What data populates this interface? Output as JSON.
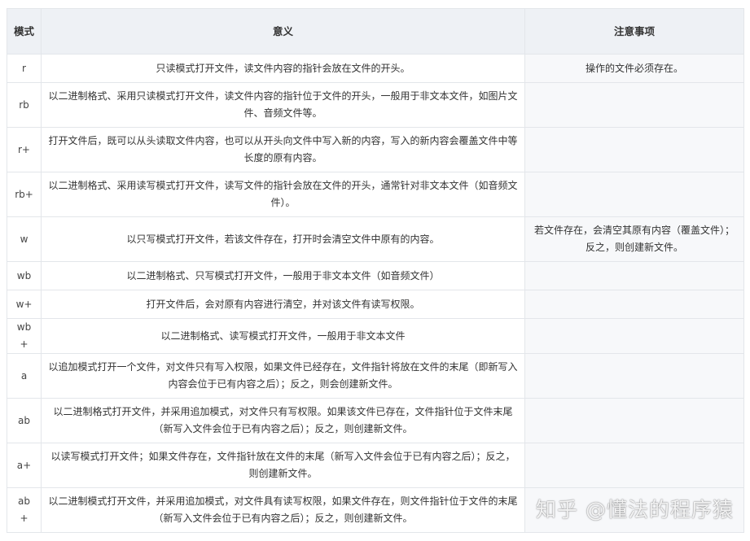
{
  "table": {
    "headers": [
      "模式",
      "意义",
      "注意事项"
    ],
    "rows": [
      {
        "mode": "r",
        "meaning": "只读模式打开文件，读文件内容的指针会放在文件的开头。",
        "notes": "操作的文件必须存在。"
      },
      {
        "mode": "rb",
        "meaning": "以二进制格式、采用只读模式打开文件，读文件内容的指针位于文件的开头，一般用于非文本文件，如图片文件、音频文件等。",
        "notes": ""
      },
      {
        "mode": "r+",
        "meaning": "打开文件后，既可以从头读取文件内容，也可以从开头向文件中写入新的内容，写入的新内容会覆盖文件中等长度的原有内容。",
        "notes": ""
      },
      {
        "mode": "rb+",
        "meaning": "以二进制格式、采用读写模式打开文件，读写文件的指针会放在文件的开头，通常针对非文本文件（如音频文件）。",
        "notes": ""
      },
      {
        "mode": "w",
        "meaning": "以只写模式打开文件，若该文件存在，打开时会清空文件中原有的内容。",
        "notes": "若文件存在，会清空其原有内容（覆盖文件）；反之，则创建新文件。"
      },
      {
        "mode": "wb",
        "meaning": "以二进制格式、只写模式打开文件，一般用于非文本文件（如音频文件）",
        "notes": ""
      },
      {
        "mode": "w+",
        "meaning": "打开文件后，会对原有内容进行清空，并对该文件有读写权限。",
        "notes": ""
      },
      {
        "mode": "wb+",
        "meaning": "以二进制格式、读写模式打开文件，一般用于非文本文件",
        "notes": ""
      },
      {
        "mode": "a",
        "meaning": "以追加模式打开一个文件，对文件只有写入权限，如果文件已经存在，文件指针将放在文件的末尾（即新写入内容会位于已有内容之后）；反之，则会创建新文件。",
        "notes": ""
      },
      {
        "mode": "ab",
        "meaning": "以二进制格式打开文件，并采用追加模式，对文件只有写权限。如果该文件已存在，文件指针位于文件末尾（新写入文件会位于已有内容之后）；反之，则创建新文件。",
        "notes": ""
      },
      {
        "mode": "a+",
        "meaning": "以读写模式打开文件；如果文件存在，文件指针放在文件的末尾（新写入文件会位于已有内容之后）；反之，则创建新文件。",
        "notes": ""
      },
      {
        "mode": "ab+",
        "meaning": "以二进制模式打开文件，并采用追加模式，对文件具有读写权限，如果文件存在，则文件指针位于文件的末尾（新写入文件会位于已有内容之后）；反之，则创建新文件。",
        "notes": ""
      }
    ]
  },
  "watermark": "知乎 @懂法的程序猿"
}
